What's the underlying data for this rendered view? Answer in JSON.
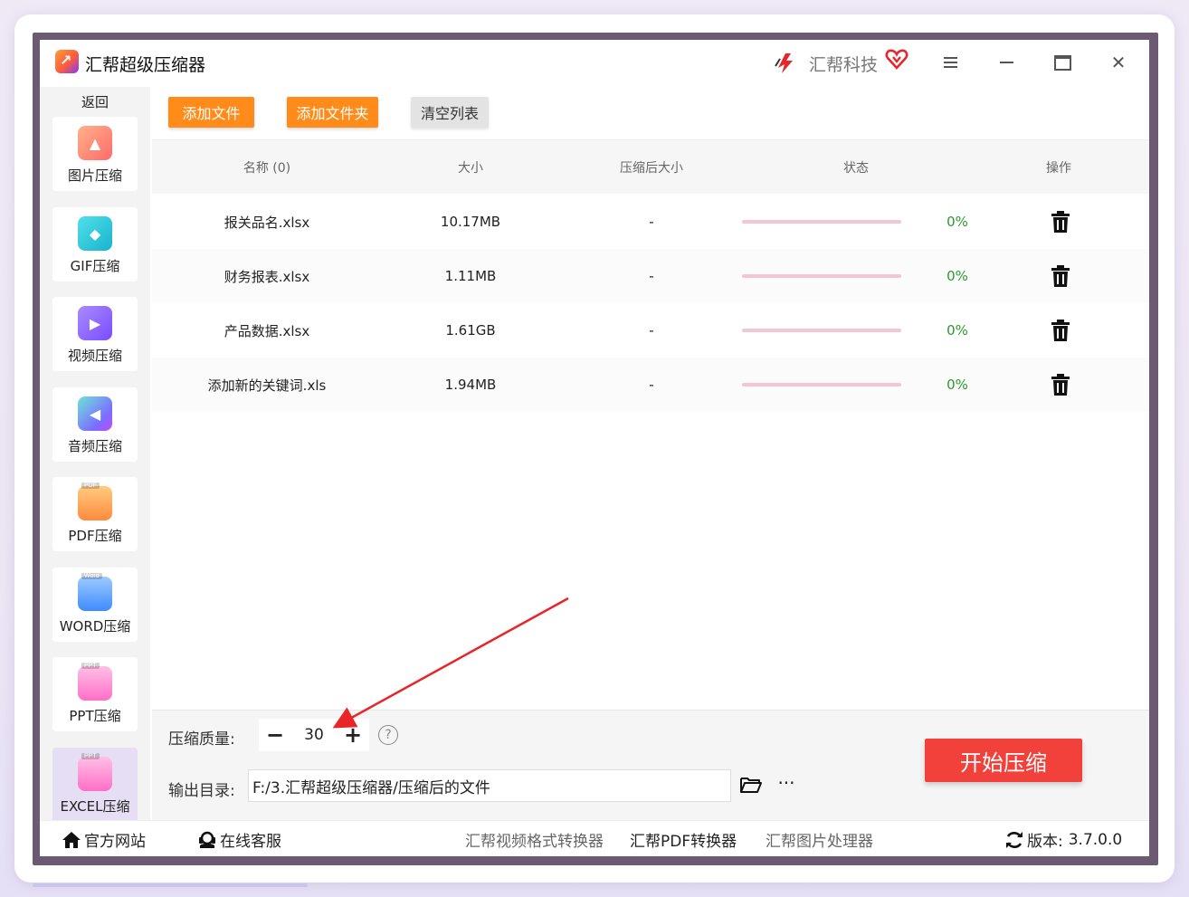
{
  "app": {
    "title": "汇帮超级压缩器",
    "brand_name": "汇帮科技"
  },
  "sidebar": {
    "back_label": "返回",
    "items": [
      {
        "label": "图片压缩",
        "icon": "image-icon"
      },
      {
        "label": "GIF压缩",
        "icon": "gif-icon"
      },
      {
        "label": "视频压缩",
        "icon": "video-icon"
      },
      {
        "label": "音频压缩",
        "icon": "audio-icon"
      },
      {
        "label": "PDF压缩",
        "icon": "pdf-file-icon",
        "tag": "PDF"
      },
      {
        "label": "WORD压缩",
        "icon": "word-file-icon",
        "tag": "Word"
      },
      {
        "label": "PPT压缩",
        "icon": "ppt-file-icon",
        "tag": "PPT"
      },
      {
        "label": "EXCEL压缩",
        "icon": "excel-file-icon",
        "tag": "PPT",
        "active": true
      }
    ]
  },
  "toolbar": {
    "add_file": "添加文件",
    "add_folder": "添加文件夹",
    "clear_list": "清空列表"
  },
  "table": {
    "columns": [
      "名称 (0)",
      "大小",
      "压缩后大小",
      "状态",
      "操作"
    ],
    "rows": [
      {
        "name": "报关品名.xlsx",
        "size": "10.17MB",
        "compressed": "-",
        "progress": 0,
        "percent": "0%"
      },
      {
        "name": "财务报表.xlsx",
        "size": "1.11MB",
        "compressed": "-",
        "progress": 0,
        "percent": "0%"
      },
      {
        "name": "产品数据.xlsx",
        "size": "1.61GB",
        "compressed": "-",
        "progress": 0,
        "percent": "0%"
      },
      {
        "name": "添加新的关键词.xls",
        "size": "1.94MB",
        "compressed": "-",
        "progress": 0,
        "percent": "0%"
      }
    ]
  },
  "settings": {
    "quality_label": "压缩质量:",
    "quality_value": "30",
    "minus": "−",
    "plus": "+",
    "help": "?",
    "output_label": "输出目录:",
    "output_path": "F:/3.汇帮超级压缩器/压缩后的文件",
    "more": "···",
    "start_button": "开始压缩"
  },
  "footer": {
    "website": "官方网站",
    "service": "在线客服",
    "video_converter": "汇帮视频格式转换器",
    "pdf_converter": "汇帮PDF转换器",
    "image_processor": "汇帮图片处理器",
    "version_label": "版本:",
    "version": "3.7.0.0"
  },
  "colors": {
    "accent_orange": "#ff8c1a",
    "start_red": "#f2413a",
    "percent_green": "#2b9a2b",
    "progress_track": "#f2c6d4",
    "annotation_arrow": "#e8262a"
  }
}
